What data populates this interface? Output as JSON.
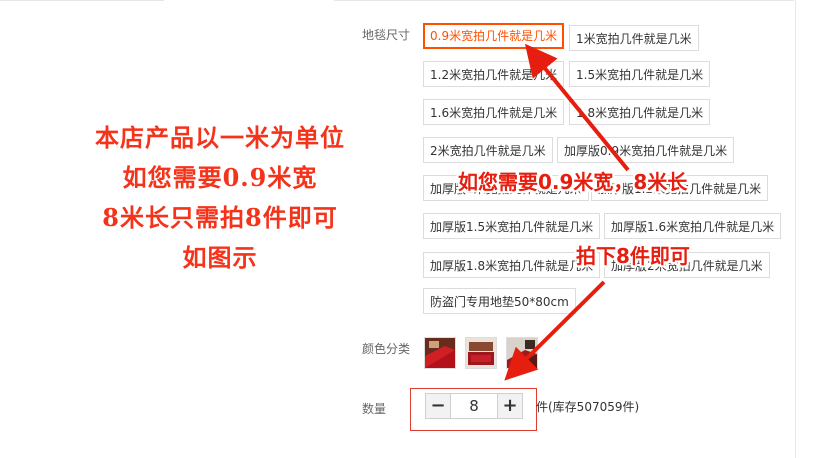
{
  "promo": {
    "lines": [
      "本店产品以一米为单位",
      "如您需要0.9米宽",
      "8米长只需拍8件即可",
      "如图示"
    ]
  },
  "sku": {
    "size_label": "地毯尺寸",
    "options": [
      "0.9米宽拍几件就是几米",
      "1米宽拍几件就是几米",
      "1.2米宽拍几件就是几米",
      "1.5米宽拍几件就是几米",
      "1.6米宽拍几件就是几米",
      "1.8米宽拍几件就是几米",
      "2米宽拍几件就是几米",
      "加厚版0.9米宽拍几件就是几米",
      "加厚版1米宽拍几件就是几米",
      "加厚版1.2米宽拍几件就是几米",
      "加厚版1.5米宽拍几件就是几米",
      "加厚版1.6米宽拍几件就是几米",
      "加厚版1.8米宽拍几件就是几米",
      "加厚版2米宽拍几件就是几米",
      "防盗门专用地垫50*80cm"
    ],
    "selected_index": 0,
    "color_label": "颜色分类",
    "color_swatch_count": 3
  },
  "quantity": {
    "label": "数量",
    "value": "8",
    "minus": "−",
    "plus": "+",
    "stock_text": "件(库存507059件)"
  },
  "annotations": {
    "top": "如您需要0.9米宽，8米长",
    "bottom": "拍下8件即可"
  },
  "colors": {
    "accent": "#ff5000",
    "annotation": "#e61e0f",
    "promo": "#f5331b"
  }
}
